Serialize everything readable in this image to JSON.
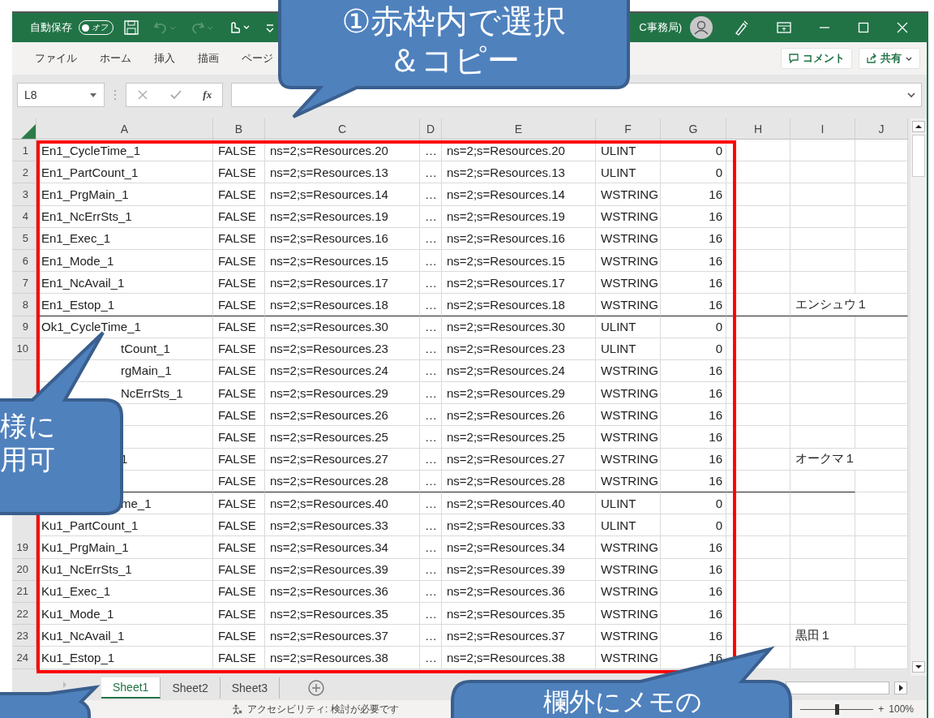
{
  "title_bar": {
    "autosave_label": "自動保存",
    "autosave_toggle": {
      "label": "オフ",
      "on": false
    },
    "title": "C事務局)"
  },
  "ribbon_tabs": [
    "ファイル",
    "ホーム",
    "挿入",
    "描画",
    "ページ"
  ],
  "comment_button": "コメント",
  "share_button": "共有",
  "name_box": "L8",
  "formula_fx": "fx",
  "columns": [
    "A",
    "B",
    "C",
    "D",
    "E",
    "F",
    "G",
    "H",
    "I",
    "J"
  ],
  "rows": [
    {
      "num": "1",
      "name": "En1_CycleTime_1",
      "covered": false,
      "flag": "FALSE",
      "node": "ns=2;s=Resources.20",
      "more": "…",
      "node_copy": "ns=2;s=Resources.20",
      "type": "ULINT",
      "size": "0",
      "group_end": false
    },
    {
      "num": "2",
      "name": "En1_PartCount_1",
      "covered": false,
      "flag": "FALSE",
      "node": "ns=2;s=Resources.13",
      "more": "…",
      "node_copy": "ns=2;s=Resources.13",
      "type": "ULINT",
      "size": "0",
      "group_end": false
    },
    {
      "num": "3",
      "name": "En1_PrgMain_1",
      "covered": false,
      "flag": "FALSE",
      "node": "ns=2;s=Resources.14",
      "more": "…",
      "node_copy": "ns=2;s=Resources.14",
      "type": "WSTRING",
      "size": "16",
      "group_end": false
    },
    {
      "num": "4",
      "name": "En1_NcErrSts_1",
      "covered": false,
      "flag": "FALSE",
      "node": "ns=2;s=Resources.19",
      "more": "…",
      "node_copy": "ns=2;s=Resources.19",
      "type": "WSTRING",
      "size": "16",
      "group_end": false
    },
    {
      "num": "5",
      "name": "En1_Exec_1",
      "covered": false,
      "flag": "FALSE",
      "node": "ns=2;s=Resources.16",
      "more": "…",
      "node_copy": "ns=2;s=Resources.16",
      "type": "WSTRING",
      "size": "16",
      "group_end": false
    },
    {
      "num": "6",
      "name": "En1_Mode_1",
      "covered": false,
      "flag": "FALSE",
      "node": "ns=2;s=Resources.15",
      "more": "…",
      "node_copy": "ns=2;s=Resources.15",
      "type": "WSTRING",
      "size": "16",
      "group_end": false
    },
    {
      "num": "7",
      "name": "En1_NcAvail_1",
      "covered": false,
      "flag": "FALSE",
      "node": "ns=2;s=Resources.17",
      "more": "…",
      "node_copy": "ns=2;s=Resources.17",
      "type": "WSTRING",
      "size": "16",
      "group_end": false
    },
    {
      "num": "8",
      "name": "En1_Estop_1",
      "covered": false,
      "flag": "FALSE",
      "node": "ns=2;s=Resources.18",
      "more": "…",
      "node_copy": "ns=2;s=Resources.18",
      "type": "WSTRING",
      "size": "16",
      "note": "エンシュウ１",
      "group_end": true
    },
    {
      "num": "9",
      "name": "Ok1_CycleTime_1",
      "covered": false,
      "flag": "FALSE",
      "node": "ns=2;s=Resources.30",
      "more": "…",
      "node_copy": "ns=2;s=Resources.30",
      "type": "ULINT",
      "size": "0",
      "group_end": false
    },
    {
      "num": "10",
      "name": "tCount_1",
      "covered": true,
      "flag": "FALSE",
      "node": "ns=2;s=Resources.23",
      "more": "…",
      "node_copy": "ns=2;s=Resources.23",
      "type": "ULINT",
      "size": "0",
      "group_end": false
    },
    {
      "name": "rgMain_1",
      "covered": true,
      "flag": "FALSE",
      "node": "ns=2;s=Resources.24",
      "more": "…",
      "node_copy": "ns=2;s=Resources.24",
      "type": "WSTRING",
      "size": "16",
      "group_end": false
    },
    {
      "name": "NcErrSts_1",
      "covered": true,
      "flag": "FALSE",
      "node": "ns=2;s=Resources.29",
      "more": "…",
      "node_copy": "ns=2;s=Resources.29",
      "type": "WSTRING",
      "size": "16",
      "group_end": false
    },
    {
      "flag": "FALSE",
      "node": "ns=2;s=Resources.26",
      "more": "…",
      "node_copy": "ns=2;s=Resources.26",
      "type": "WSTRING",
      "size": "16",
      "group_end": false
    },
    {
      "flag": "FALSE",
      "node": "ns=2;s=Resources.25",
      "more": "…",
      "node_copy": "ns=2;s=Resources.25",
      "type": "WSTRING",
      "size": "16",
      "group_end": false
    },
    {
      "name": "1",
      "covered": true,
      "flag": "FALSE",
      "node": "ns=2;s=Resources.27",
      "more": "…",
      "node_copy": "ns=2;s=Resources.27",
      "type": "WSTRING",
      "size": "16",
      "note": "オークマ１",
      "group_end": false
    },
    {
      "flag": "FALSE",
      "node": "ns=2;s=Resources.28",
      "more": "…",
      "node_copy": "ns=2;s=Resources.28",
      "type": "WSTRING",
      "size": "16",
      "group_end": true
    },
    {
      "name": "me_1",
      "covered": true,
      "flag": "FALSE",
      "node": "ns=2;s=Resources.40",
      "more": "…",
      "node_copy": "ns=2;s=Resources.40",
      "type": "ULINT",
      "size": "0",
      "group_end": false
    },
    {
      "name": "Ku1_PartCount_1",
      "covered": false,
      "flag": "FALSE",
      "node": "ns=2;s=Resources.33",
      "more": "…",
      "node_copy": "ns=2;s=Resources.33",
      "type": "ULINT",
      "size": "0",
      "group_end": false
    },
    {
      "num": "19",
      "name": "Ku1_PrgMain_1",
      "covered": false,
      "flag": "FALSE",
      "node": "ns=2;s=Resources.34",
      "more": "…",
      "node_copy": "ns=2;s=Resources.34",
      "type": "WSTRING",
      "size": "16",
      "group_end": false
    },
    {
      "num": "20",
      "name": "Ku1_NcErrSts_1",
      "covered": false,
      "flag": "FALSE",
      "node": "ns=2;s=Resources.39",
      "more": "…",
      "node_copy": "ns=2;s=Resources.39",
      "type": "WSTRING",
      "size": "16",
      "group_end": false
    },
    {
      "num": "21",
      "name": "Ku1_Exec_1",
      "covered": false,
      "flag": "FALSE",
      "node": "ns=2;s=Resources.36",
      "more": "…",
      "node_copy": "ns=2;s=Resources.36",
      "type": "WSTRING",
      "size": "16",
      "group_end": false
    },
    {
      "num": "22",
      "name": "Ku1_Mode_1",
      "covered": false,
      "flag": "FALSE",
      "node": "ns=2;s=Resources.35",
      "more": "…",
      "node_copy": "ns=2;s=Resources.35",
      "type": "WSTRING",
      "size": "16",
      "group_end": false
    },
    {
      "num": "23",
      "name": "Ku1_NcAvail_1",
      "covered": false,
      "flag": "FALSE",
      "node": "ns=2;s=Resources.37",
      "more": "…",
      "node_copy": "ns=2;s=Resources.37",
      "type": "WSTRING",
      "size": "16",
      "note": "黒田１",
      "group_end": false
    },
    {
      "num": "24",
      "name": "Ku1_Estop_1",
      "covered": false,
      "flag": "FALSE",
      "node": "ns=2;s=Resources.38",
      "more": "…",
      "node_copy": "ns=2;s=Resources.38",
      "type": "WSTRING",
      "size": "16",
      "group_end": false
    }
  ],
  "sheet_tabs": [
    {
      "label": "Sheet1",
      "selected": true
    },
    {
      "label": "Sheet2",
      "selected": false
    },
    {
      "label": "Sheet3",
      "selected": false
    }
  ],
  "status_bar": {
    "accessibility": "アクセシビリティ: 検討が必要です",
    "zoom_plus": "+",
    "zoom": "100%",
    "zoom_slider": {
      "level": 0.5
    }
  },
  "callouts": [
    {
      "kind": "top",
      "lines": [
        "①赤枠内で選択",
        "＆コピー"
      ]
    },
    {
      "kind": "left",
      "lines": [
        "様に",
        "用可"
      ]
    },
    {
      "kind": "bottom",
      "lines": [
        "欄外にメモの"
      ]
    },
    {
      "kind": "corner"
    }
  ]
}
